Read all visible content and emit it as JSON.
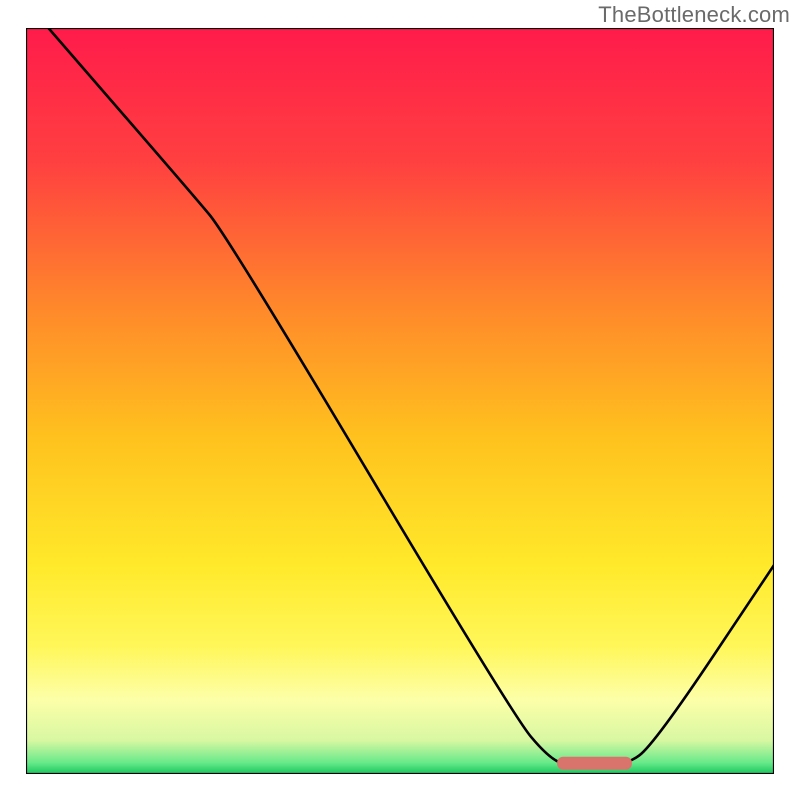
{
  "attribution": "TheBottleneck.com",
  "chart_data": {
    "type": "line",
    "title": "",
    "xlabel": "",
    "ylabel": "",
    "xlim": [
      0,
      100
    ],
    "ylim": [
      0,
      100
    ],
    "annotations": [],
    "series": [
      {
        "name": "curve",
        "color": "#000000",
        "points": [
          {
            "x": 3,
            "y": 100
          },
          {
            "x": 22,
            "y": 78
          },
          {
            "x": 27,
            "y": 72
          },
          {
            "x": 65,
            "y": 8
          },
          {
            "x": 70,
            "y": 2
          },
          {
            "x": 73,
            "y": 1
          },
          {
            "x": 80,
            "y": 1
          },
          {
            "x": 84,
            "y": 4
          },
          {
            "x": 100,
            "y": 28
          }
        ]
      }
    ],
    "optimal_marker": {
      "x_start": 71,
      "x_end": 81,
      "y": 1.5,
      "color": "#d9746c"
    },
    "background_gradient": {
      "stops": [
        {
          "offset": 0.0,
          "color": "#ff1b4b"
        },
        {
          "offset": 0.18,
          "color": "#ff4040"
        },
        {
          "offset": 0.38,
          "color": "#ff8a2a"
        },
        {
          "offset": 0.55,
          "color": "#ffc21e"
        },
        {
          "offset": 0.72,
          "color": "#ffe92a"
        },
        {
          "offset": 0.83,
          "color": "#fff75a"
        },
        {
          "offset": 0.9,
          "color": "#fdffa8"
        },
        {
          "offset": 0.955,
          "color": "#d8f7a2"
        },
        {
          "offset": 0.985,
          "color": "#67e98a"
        },
        {
          "offset": 1.0,
          "color": "#17c65d"
        }
      ]
    }
  }
}
